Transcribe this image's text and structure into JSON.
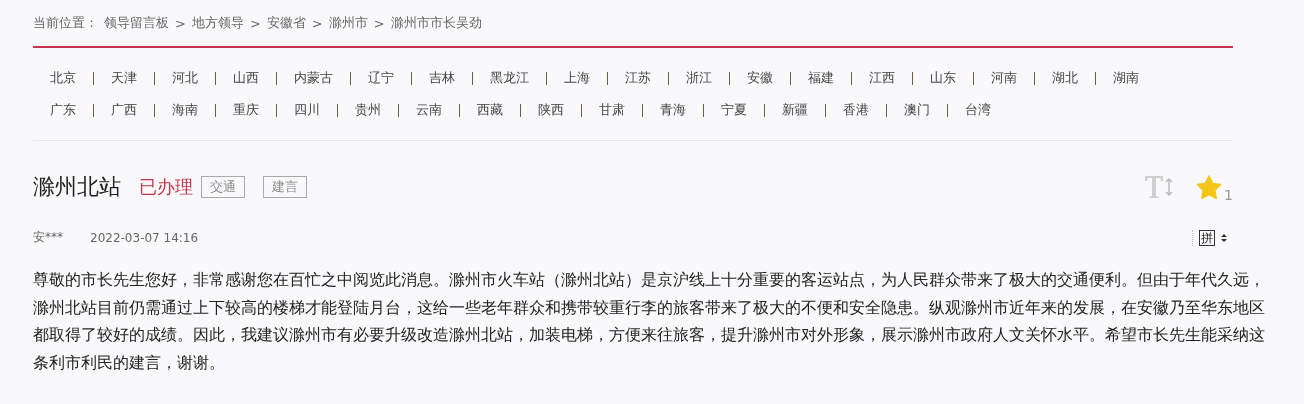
{
  "breadcrumb": {
    "label": "当前位置：",
    "items": [
      "领导留言板",
      "地方领导",
      "安徽省",
      "滁州市",
      "滁州市市长吴劲"
    ],
    "separator": ">"
  },
  "provinces": [
    [
      "北京",
      "天津",
      "河北",
      "山西",
      "内蒙古",
      "辽宁",
      "吉林",
      "黑龙江",
      "上海",
      "江苏",
      "浙江",
      "安徽",
      "福建",
      "江西",
      "山东",
      "河南",
      "湖北",
      "湖南"
    ],
    [
      "广东",
      "广西",
      "海南",
      "重庆",
      "四川",
      "贵州",
      "云南",
      "西藏",
      "陕西",
      "甘肃",
      "青海",
      "宁夏",
      "新疆",
      "香港",
      "澳门",
      "台湾"
    ]
  ],
  "message": {
    "title": "滁州北站",
    "status": "已办理",
    "tags": [
      "交通",
      "建言"
    ],
    "star_count": "1",
    "author": "安***",
    "time": "2022-03-07 14:16",
    "input_mode": "拼",
    "body": "尊敬的市长先生您好，非常感谢您在百忙之中阅览此消息。滁州市火车站（滁州北站）是京沪线上十分重要的客运站点，为人民群众带来了极大的交通便利。但由于年代久远，滁州北站目前仍需通过上下较高的楼梯才能登陆月台，这给一些老年群众和携带较重行李的旅客带来了极大的不便和安全隐患。纵观滁州市近年来的发展，在安徽乃至华东地区都取得了较好的成绩。因此，我建议滁州市有必要升级改造滁州北站，加装电梯，方便来往旅客，提升滁州市对外形象，展示滁州市政府人文关怀水平。希望市长先生能采纳这条利市利民的建言，谢谢。"
  }
}
